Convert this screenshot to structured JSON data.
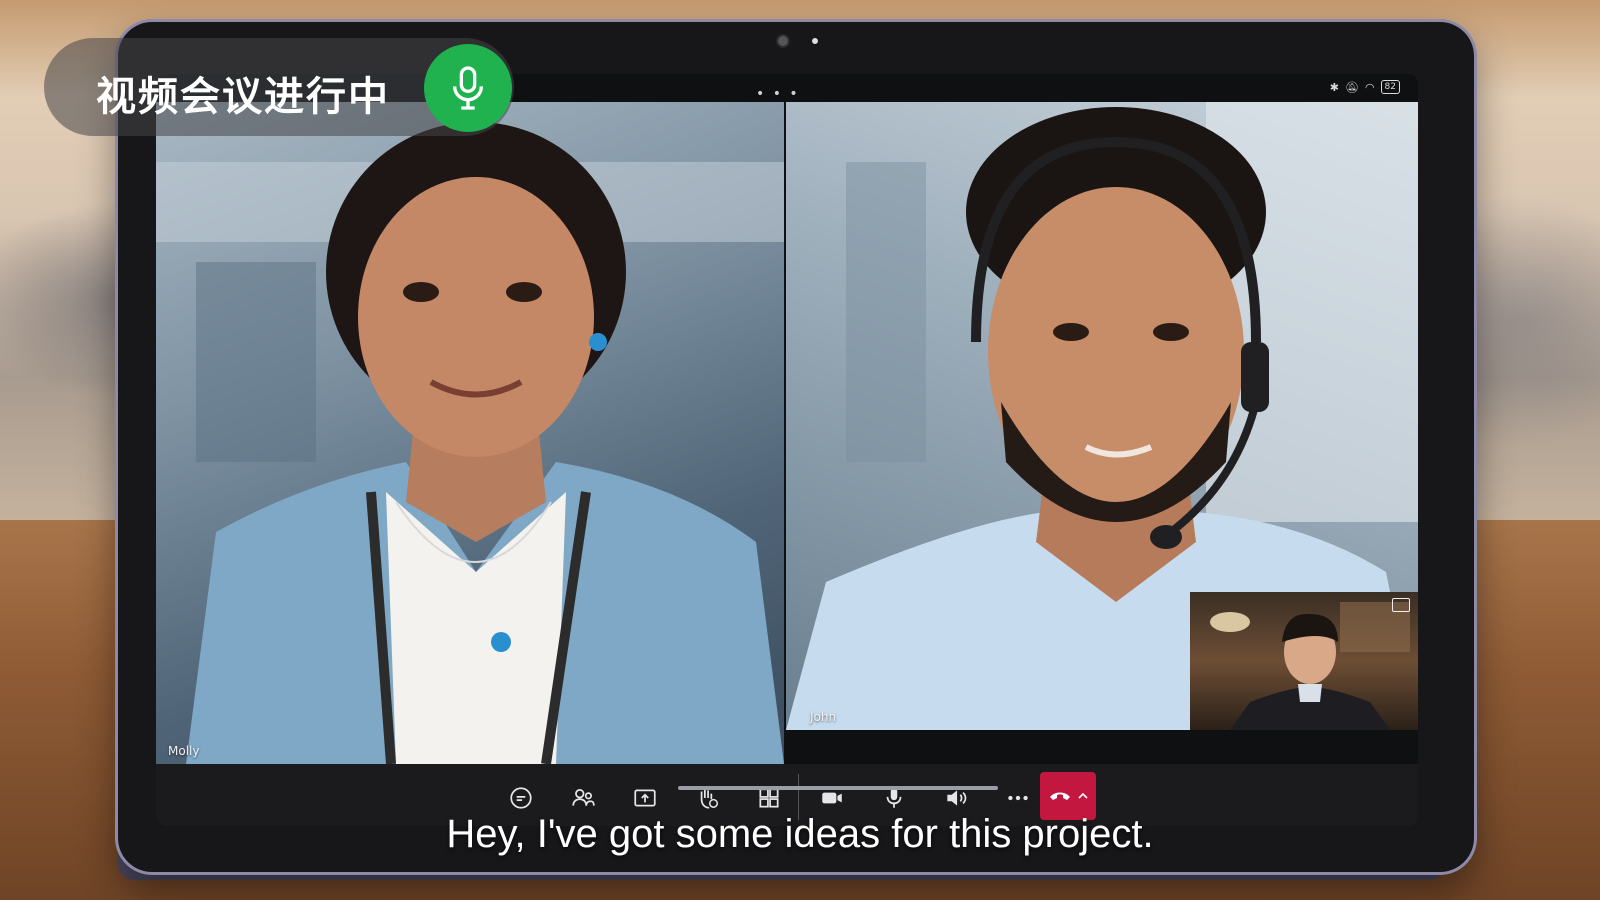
{
  "overlay": {
    "status_text": "视频会议进行中",
    "mic_icon": "microphone-icon",
    "mic_color": "#1fb24f"
  },
  "device": {
    "battery_level": "82",
    "status_icons": [
      "bluetooth-icon",
      "mute-bell-icon",
      "wifi-icon",
      "battery-icon"
    ]
  },
  "participants": {
    "left_name": "Molly",
    "right_name": "John"
  },
  "toolbar": {
    "buttons": [
      "chat-icon",
      "participants-icon",
      "share-screen-icon",
      "raise-hand-icon",
      "layout-grid-icon",
      "camera-icon",
      "microphone-icon",
      "speaker-icon",
      "more-icon"
    ],
    "end_call_color": "#c4173f"
  },
  "caption": "Hey, I've got some ideas for this project."
}
